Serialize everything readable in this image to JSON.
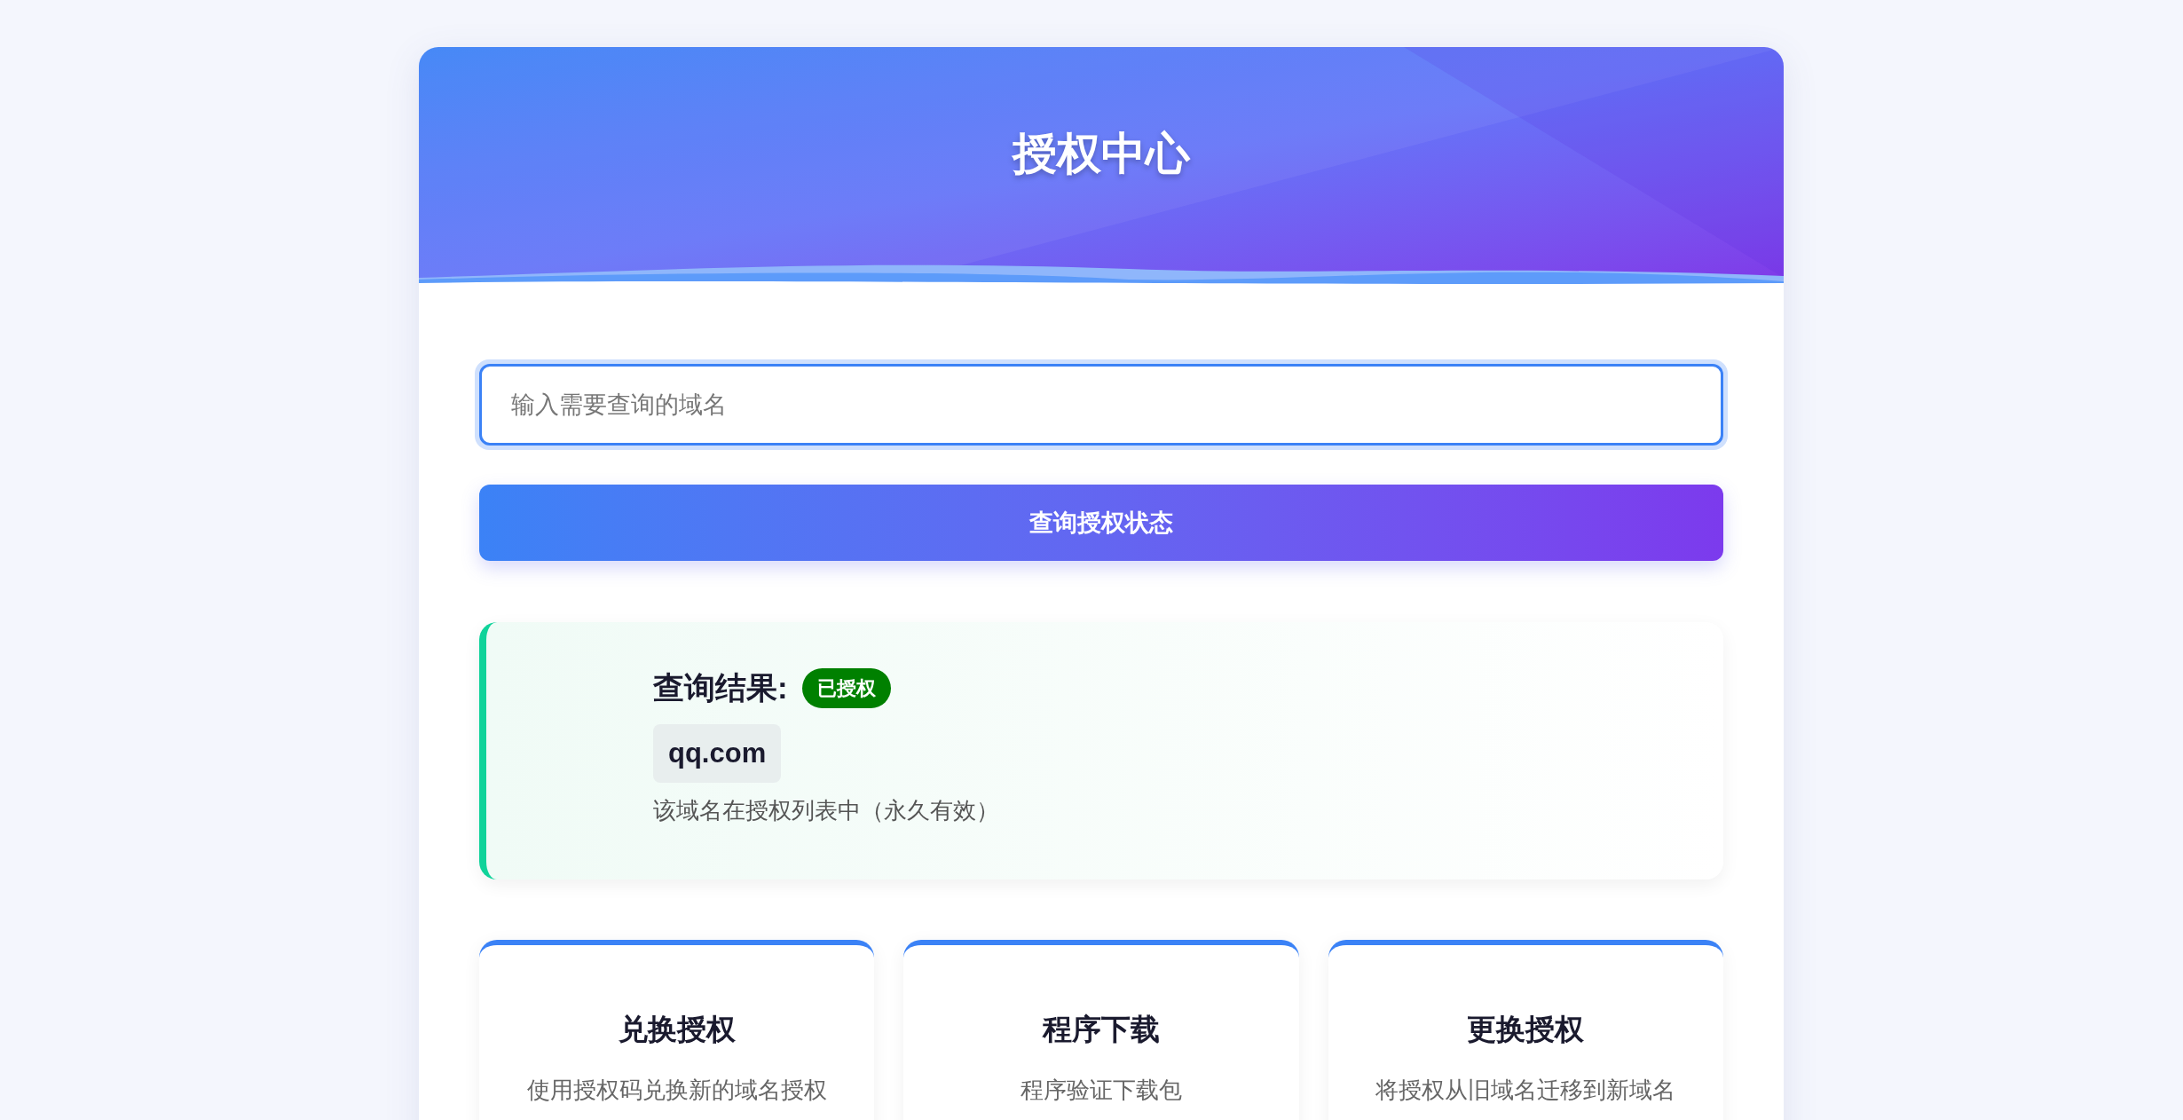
{
  "header": {
    "title": "授权中心"
  },
  "search": {
    "placeholder": "输入需要查询的域名"
  },
  "query_button": "查询授权状态",
  "result": {
    "title": "查询结果:",
    "status": {
      "label": "已授权",
      "kind": "authorized"
    },
    "domain": "qq.com",
    "message": "该域名在授权列表中（永久有效）"
  },
  "features": [
    {
      "title": "兑换授权",
      "description": "使用授权码兑换新的域名授权"
    },
    {
      "title": "程序下载",
      "description": "程序验证下载包"
    },
    {
      "title": "更换授权",
      "description": "将授权从旧域名迁移到新域名"
    }
  ]
}
